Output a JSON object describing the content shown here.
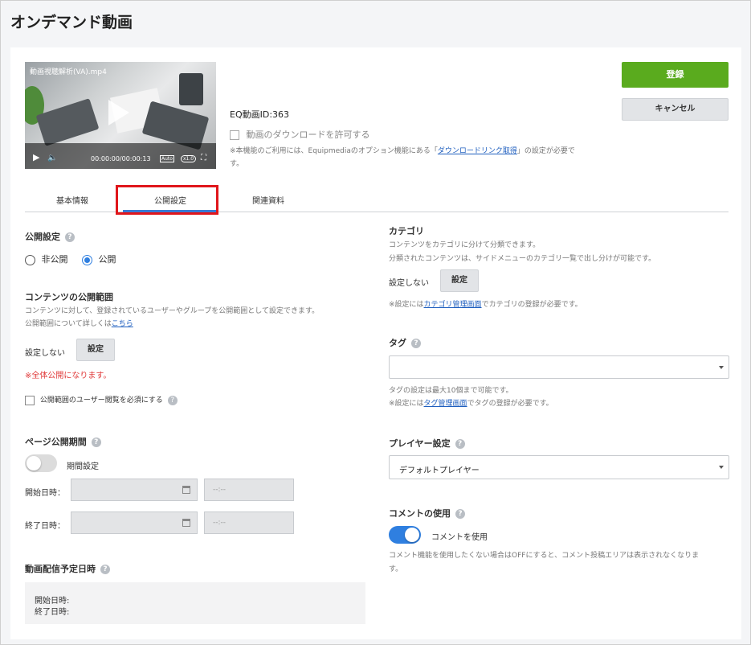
{
  "page_title": "オンデマンド動画",
  "video": {
    "filename": "動画視聴解析(VA).mp4",
    "time": "00:00:00/00:00:13",
    "auto_label": "Auto",
    "speed_label": "x1.0"
  },
  "eq_id": "EQ動画ID:363",
  "download": {
    "label": "動画のダウンロードを許可する",
    "note_prefix": "※本機能のご利用には、Equipmediaのオプション機能にある「",
    "note_link": "ダウンロードリンク取得",
    "note_suffix": "」の設定が必要で",
    "note_line2": "す。"
  },
  "buttons": {
    "register": "登録",
    "cancel": "キャンセル"
  },
  "tabs": [
    {
      "label": "基本情報"
    },
    {
      "label": "公開設定"
    },
    {
      "label": "関連資料"
    }
  ],
  "left": {
    "visibility": {
      "heading": "公開設定",
      "option_private": "非公開",
      "option_public": "公開"
    },
    "scope": {
      "heading": "コンテンツの公開範囲",
      "desc1": "コンテンツに対して、登録されているユーザーやグループを公開範囲として設定できます。",
      "desc2_prefix": "公開範囲について詳しくは",
      "desc2_link": "こちら",
      "none_label": "設定しない",
      "set_button": "設定",
      "warning": "※全体公開になります。",
      "require_view_label": "公開範囲のユーザー閲覧を必須にする"
    },
    "period": {
      "heading": "ページ公開期間",
      "toggle_label": "期間設定",
      "start_label": "開始日時：",
      "end_label": "終了日時：",
      "time_placeholder": "--:--"
    },
    "schedule": {
      "heading": "動画配信予定日時",
      "start_label": "開始日時:",
      "end_label": "終了日時:"
    }
  },
  "right": {
    "category": {
      "heading": "カテゴリ",
      "desc1": "コンテンツをカテゴリに分けて分類できます。",
      "desc2": "分類されたコンテンツは、サイドメニューのカテゴリ一覧で出し分けが可能です。",
      "none_label": "設定しない",
      "set_button": "設定",
      "note_prefix": "※設定には",
      "note_link": "カテゴリ管理画面",
      "note_suffix": "でカテゴリの登録が必要です。"
    },
    "tag": {
      "heading": "タグ",
      "note1": "タグの設定は最大10個まで可能です。",
      "note2_prefix": "※設定には",
      "note2_link": "タグ管理画面",
      "note2_suffix": "でタグの登録が必要です。"
    },
    "player": {
      "heading": "プレイヤー設定",
      "selected": "デフォルトプレイヤー"
    },
    "comment": {
      "heading": "コメントの使用",
      "toggle_label": "コメントを使用",
      "desc1": "コメント機能を使用したくない場合はOFFにすると、コメント投稿エリアは表示されなくなりま",
      "desc2": "す。"
    }
  },
  "colors": {
    "accent": "#3a7bd5",
    "register": "#5aab1e",
    "warning": "#e03a3a",
    "highlight": "#e0161b",
    "toggle_on": "#2f7fe0"
  }
}
